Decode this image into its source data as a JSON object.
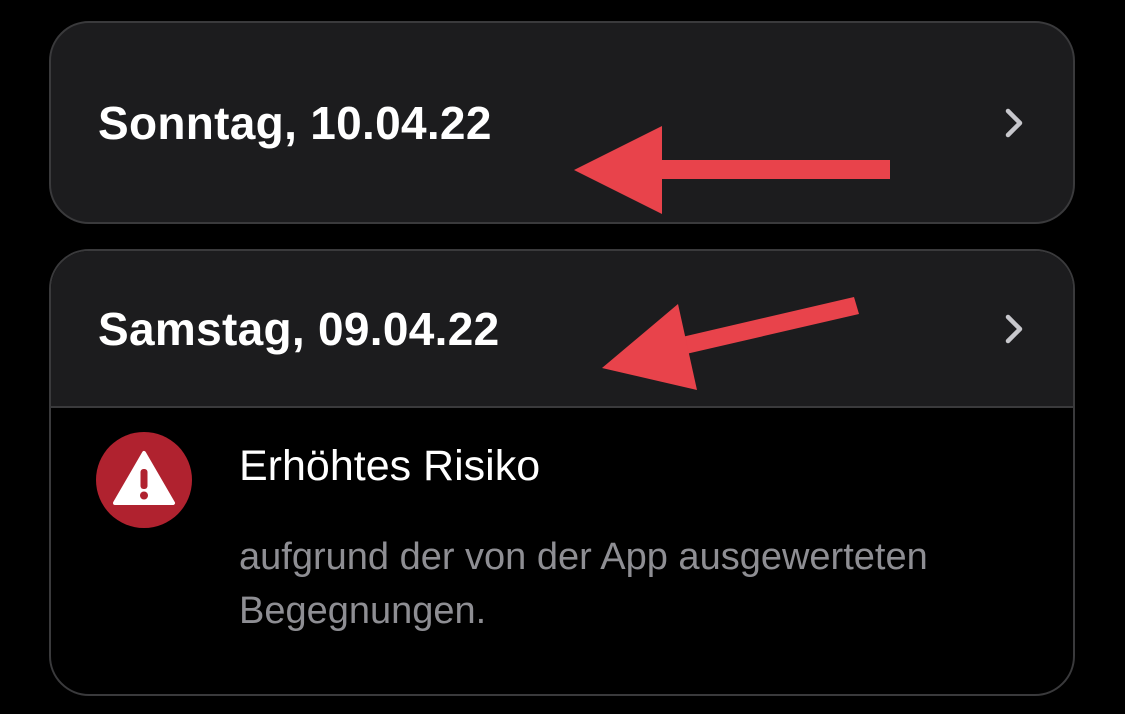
{
  "days": [
    {
      "label": "Sonntag, 10.04.22",
      "chevron_icon": "chevron-right-icon"
    },
    {
      "label": "Samstag, 09.04.22",
      "chevron_icon": "chevron-right-icon",
      "risk": {
        "icon": "warning-triangle-icon",
        "title": "Erhöhtes Risiko",
        "description": "aufgrund der von der App ausgewerteten Begegnungen."
      }
    }
  ],
  "annotations": {
    "arrow_icon": "arrow-left-icon",
    "arrow_color": "#e8434b"
  },
  "colors": {
    "background": "#000000",
    "card_background": "#1c1c1e",
    "card_border": "#3a3a3c",
    "risk_red": "#b0222f",
    "secondary_text": "#8e8e93"
  }
}
